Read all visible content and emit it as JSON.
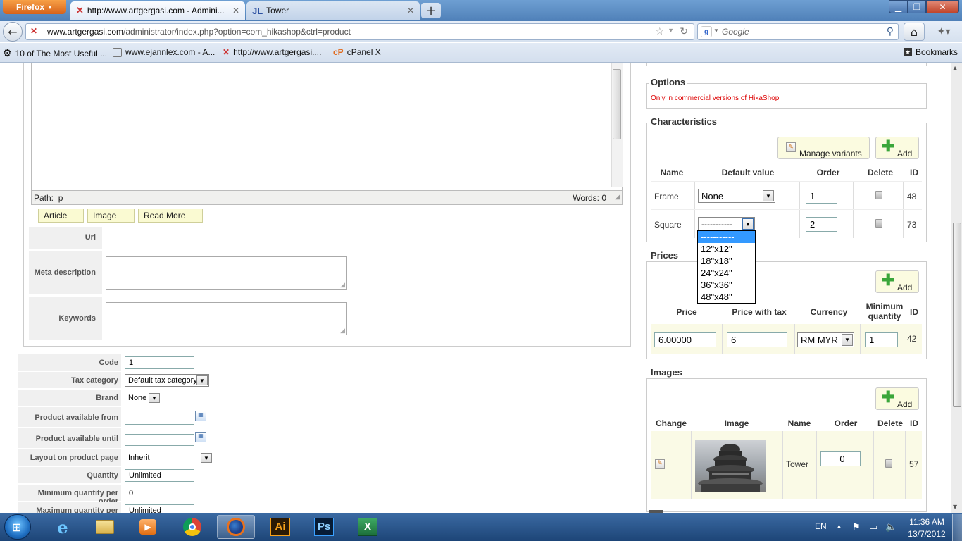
{
  "browser": {
    "app_button": "Firefox",
    "tabs": [
      {
        "title": "http://www.artgergasi.com - Admini..."
      },
      {
        "title": "Tower"
      }
    ],
    "url": {
      "domain": "www.artgergasi.com",
      "path": "/administrator/index.php?option=com_hikashop&ctrl=product"
    },
    "search_placeholder": "Google",
    "bookmarks": [
      {
        "label": "10 of The Most Useful ..."
      },
      {
        "label": "www.ejannlex.com - A..."
      },
      {
        "label": "http://www.artgergasi...."
      },
      {
        "label": "cPanel X"
      }
    ],
    "bookmarks_menu": "Bookmarks"
  },
  "editor": {
    "path_label": "Path:",
    "path_value": "p",
    "words_label": "Words: 0",
    "buttons": [
      "Article",
      "Image",
      "Read More"
    ]
  },
  "meta": {
    "url_label": "Url",
    "meta_description_label": "Meta description",
    "keywords_label": "Keywords"
  },
  "product_fields": [
    {
      "label": "Code",
      "value": "1"
    },
    {
      "label": "Tax category",
      "value": "Default tax category"
    },
    {
      "label": "Brand",
      "value": "None"
    },
    {
      "label": "Product available from",
      "value": ""
    },
    {
      "label": "Product available until",
      "value": ""
    },
    {
      "label": "Layout on product page",
      "value": "Inherit"
    },
    {
      "label": "Quantity",
      "value": "Unlimited"
    },
    {
      "label": "Minimum quantity per order",
      "value": "0"
    },
    {
      "label": "Maximum quantity per order",
      "value": "Unlimited"
    }
  ],
  "options": {
    "title": "Options",
    "note": "Only in commercial versions of HikaShop"
  },
  "characteristics": {
    "title": "Characteristics",
    "manage_variants": "Manage variants",
    "add": "Add",
    "headers": [
      "Name",
      "Default value",
      "Order",
      "Delete",
      "ID"
    ],
    "rows": [
      {
        "name": "Frame",
        "default": "None",
        "order": "1",
        "id": "48"
      },
      {
        "name": "Square",
        "default": "-----------",
        "order": "2",
        "id": "73"
      }
    ],
    "dropdown_options": [
      "-----------",
      "12\"x12\"",
      "18\"x18\"",
      "24\"x24\"",
      "36\"x36\"",
      "48\"x48\""
    ]
  },
  "prices": {
    "title": "Prices",
    "add": "Add",
    "headers": [
      "Price",
      "Price with tax",
      "Currency",
      "Minimum quantity",
      "ID"
    ],
    "row": {
      "price": "6.00000",
      "price_with_tax": "6",
      "currency": "RM MYR",
      "min_qty": "1",
      "id": "42"
    }
  },
  "images": {
    "title": "Images",
    "add": "Add",
    "headers": [
      "Change",
      "Image",
      "Name",
      "Order",
      "Delete",
      "ID"
    ],
    "row": {
      "name": "Tower",
      "order": "0",
      "id": "57"
    }
  },
  "taskbar": {
    "language": "EN",
    "time": "11:36 AM",
    "date": "13/7/2012",
    "apps": [
      "start",
      "ie",
      "explorer",
      "media",
      "chrome",
      "firefox",
      "illustrator",
      "photoshop",
      "excel"
    ]
  }
}
